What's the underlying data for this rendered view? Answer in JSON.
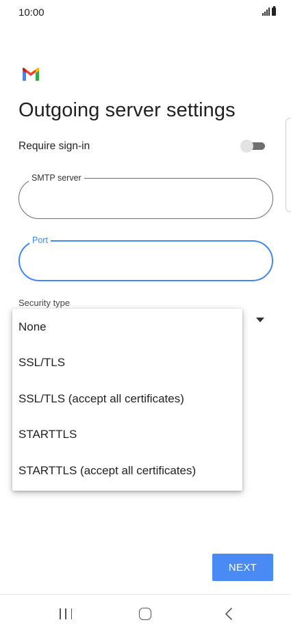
{
  "status_bar": {
    "time": "10:00",
    "icons": [
      "signal-icon",
      "battery-icon"
    ]
  },
  "app": {
    "logo": "gmail-logo",
    "title": "Outgoing server settings"
  },
  "require_signin": {
    "label": "Require sign-in",
    "enabled": false
  },
  "smtp_field": {
    "label": "SMTP server",
    "value": ""
  },
  "port_field": {
    "label": "Port",
    "value": "",
    "focused": true
  },
  "security": {
    "label": "Security type",
    "options": [
      "None",
      "SSL/TLS",
      "SSL/TLS (accept all certificates)",
      "STARTTLS",
      "STARTTLS (accept all certificates)"
    ]
  },
  "next_button": {
    "label": "NEXT"
  },
  "nav_bar": {
    "icons": [
      "recent-apps-icon",
      "home-icon",
      "back-icon"
    ]
  },
  "colors": {
    "accent": "#4285f4",
    "button": "#4a8af4",
    "text": "#202124"
  }
}
